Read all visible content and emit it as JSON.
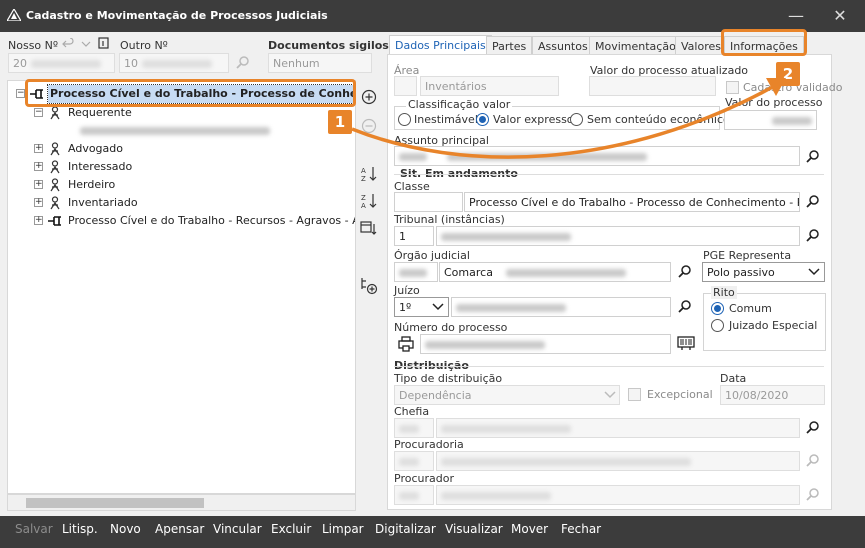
{
  "window": {
    "title": "Cadastro e Movimentação de Processos Judiciais",
    "min_glyph": "—",
    "close_glyph": "✕"
  },
  "header_fields": {
    "nosso_label": "Nosso Nº",
    "nosso_value": "20",
    "outro_label": "Outro Nº",
    "outro_value": "10",
    "sigilosos_label": "Documentos sigilosos",
    "sigilosos_value": "Nenhum"
  },
  "tree": {
    "root_label": "Processo Cível e do Trabalho - Processo de Conhecimento",
    "items": [
      {
        "label": "Requerente"
      },
      {
        "label": "Advogado"
      },
      {
        "label": "Interessado"
      },
      {
        "label": "Herdeiro"
      },
      {
        "label": "Inventariado"
      },
      {
        "label": "Processo Cível e do Trabalho - Recursos - Agravos - Agravo"
      }
    ]
  },
  "callouts": {
    "one": "1",
    "two": "2"
  },
  "tabs": [
    "Dados Principais",
    "Partes",
    "Assuntos",
    "Movimentação",
    "Valores",
    "Informações"
  ],
  "form": {
    "area_label": "Área",
    "area_value": "Inventários",
    "valor_atualizado_label": "Valor do processo atualizado",
    "cadastro_validado_label": "Cadastro validado",
    "classificacao_label": "Classificação valor",
    "radio_inestimavel": "Inestimável",
    "radio_expresso": "Valor expresso",
    "radio_sem_conteudo": "Sem conteúdo econômico",
    "valor_processo_label": "Valor do processo",
    "assunto_label": "Assunto principal",
    "sit_label": "Sit. Em andamento",
    "classe_label": "Classe",
    "classe_value": "Processo Cível e do Trabalho - Processo de Conhecimento - Proce",
    "tribunal_label": "Tribunal (instâncias)",
    "tribunal_code": "1",
    "orgao_label": "Órgão judicial",
    "orgao_value": "Comarca",
    "pge_label": "PGE Representa",
    "pge_value": "Polo passivo",
    "juizo_label": "Juízo",
    "juizo_value": "1º",
    "rito_label": "Rito",
    "rito_comum": "Comum",
    "rito_juizado": "Juizado Especial",
    "numero_label": "Número do processo",
    "distribuicao_label": "Distribuição",
    "tipo_dist_label": "Tipo de distribuição",
    "tipo_dist_value": "Dependência",
    "excepcional_label": "Excepcional",
    "data_label": "Data",
    "data_value": "10/08/2020",
    "chefia_label": "Chefia",
    "procuradoria_label": "Procuradoria",
    "procurador_label": "Procurador"
  },
  "bottom_buttons": [
    {
      "label": "Salvar",
      "disabled": true
    },
    {
      "label": "Litisp."
    },
    {
      "label": "Novo"
    },
    {
      "label": "Apensar"
    },
    {
      "label": "Vincular"
    },
    {
      "label": "Excluir"
    },
    {
      "label": "Limpar"
    },
    {
      "label": "Digitalizar"
    },
    {
      "label": "Visualizar"
    },
    {
      "label": "Mover"
    },
    {
      "label": "Fechar"
    }
  ],
  "colors": {
    "accent": "#1e63b5",
    "callout": "#e8842a",
    "titlebar": "#3c3c3c"
  },
  "icons": [
    "app-icon",
    "minimize-icon",
    "close-icon",
    "undo-icon",
    "chevron-down-icon",
    "attach-icon",
    "search-icon",
    "add-circle-icon",
    "remove-circle-icon",
    "sort-az-icon",
    "sort-za-icon",
    "calendar-sort-icon",
    "tree-add-icon",
    "person-icon",
    "process-icon",
    "printer-icon",
    "barcode-icon"
  ]
}
